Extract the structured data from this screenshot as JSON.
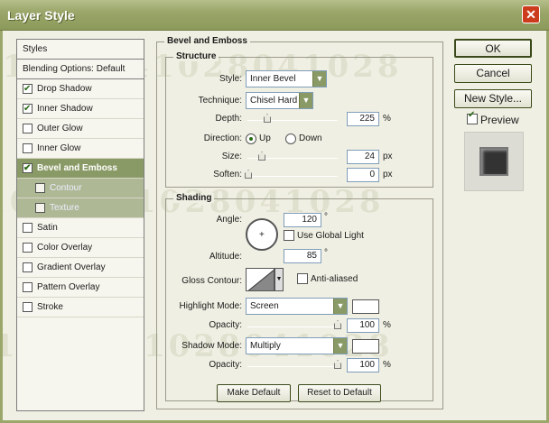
{
  "window": {
    "title": "Layer Style",
    "close_glyph": "✕"
  },
  "styles_list": {
    "header": "Styles",
    "blending": "Blending Options: Default",
    "items": [
      {
        "label": "Drop Shadow",
        "checked": true
      },
      {
        "label": "Inner Shadow",
        "checked": true
      },
      {
        "label": "Outer Glow",
        "checked": false
      },
      {
        "label": "Inner Glow",
        "checked": false
      },
      {
        "label": "Bevel and Emboss",
        "checked": true
      },
      {
        "label": "Contour",
        "checked": false
      },
      {
        "label": "Texture",
        "checked": false
      },
      {
        "label": "Satin",
        "checked": false
      },
      {
        "label": "Color Overlay",
        "checked": false
      },
      {
        "label": "Gradient Overlay",
        "checked": false
      },
      {
        "label": "Pattern Overlay",
        "checked": false
      },
      {
        "label": "Stroke",
        "checked": false
      }
    ]
  },
  "bevel": {
    "title": "Bevel and Emboss",
    "structure_title": "Structure",
    "style_label": "Style:",
    "style_value": "Inner Bevel",
    "technique_label": "Technique:",
    "technique_value": "Chisel Hard",
    "depth_label": "Depth:",
    "depth_value": "225",
    "depth_unit": "%",
    "direction_label": "Direction:",
    "direction_up": "Up",
    "direction_down": "Down",
    "size_label": "Size:",
    "size_value": "24",
    "size_unit": "px",
    "soften_label": "Soften:",
    "soften_value": "0",
    "soften_unit": "px"
  },
  "shading": {
    "title": "Shading",
    "angle_label": "Angle:",
    "angle_value": "120",
    "angle_unit": "°",
    "global_light_label": "Use Global Light",
    "altitude_label": "Altitude:",
    "altitude_value": "85",
    "altitude_unit": "°",
    "gloss_label": "Gloss Contour:",
    "anti_aliased_label": "Anti-aliased",
    "highlight_mode_label": "Highlight Mode:",
    "highlight_mode_value": "Screen",
    "highlight_opacity_label": "Opacity:",
    "highlight_opacity_value": "100",
    "highlight_opacity_unit": "%",
    "shadow_mode_label": "Shadow Mode:",
    "shadow_mode_value": "Multiply",
    "shadow_opacity_label": "Opacity:",
    "shadow_opacity_value": "100",
    "shadow_opacity_unit": "%"
  },
  "buttons": {
    "ok": "OK",
    "cancel": "Cancel",
    "new_style": "New Style...",
    "preview": "Preview",
    "make_default": "Make Default",
    "reset_default": "Reset to Default"
  },
  "watermark": "1028041028041028",
  "colors": {
    "titlebar": "#9aa66a",
    "selected": "#8a9a66",
    "close": "#cc3b1c"
  }
}
